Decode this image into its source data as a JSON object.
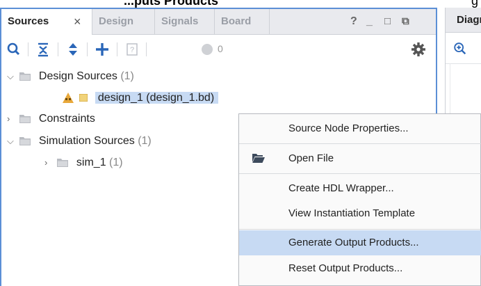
{
  "top_caption": {
    "left_text": "...puts Products",
    "right_text": "g"
  },
  "sources_panel": {
    "tabs": [
      {
        "label": "Sources",
        "active": true
      },
      {
        "label": "Design",
        "active": false
      },
      {
        "label": "Signals",
        "active": false
      },
      {
        "label": "Board",
        "active": false
      }
    ],
    "window_controls": {
      "help": "?",
      "minimize": "_",
      "maximize": "□",
      "float": "⧉"
    },
    "toolbar": {
      "badge_count": "0"
    },
    "tree": {
      "design_sources": {
        "label": "Design Sources",
        "count": "(1)"
      },
      "design_1": {
        "label": "design_1 (design_1.bd)"
      },
      "constraints": {
        "label": "Constraints"
      },
      "simulation_sources": {
        "label": "Simulation Sources",
        "count": "(1)"
      },
      "sim_1": {
        "label": "sim_1",
        "count": "(1)"
      }
    }
  },
  "diagram_panel": {
    "tab_label": "Diagram"
  },
  "context_menu": {
    "items": [
      {
        "label": "Source Node Properties..."
      },
      {
        "label": "Open File"
      },
      {
        "label": "Create HDL Wrapper..."
      },
      {
        "label": "View Instantiation Template"
      },
      {
        "label": "Generate Output Products..."
      },
      {
        "label": "Reset Output Products..."
      }
    ],
    "highlighted_item": "Generate Output Products..."
  },
  "colors": {
    "accent_border": "#5b8fd6",
    "selection": "#c7daf3",
    "tab_bar": "#e9eaee"
  }
}
